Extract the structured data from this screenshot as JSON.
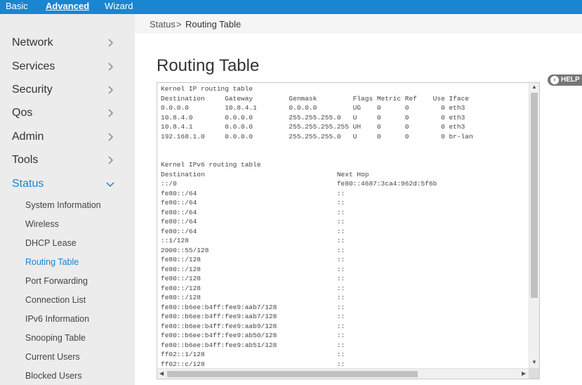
{
  "topbar": {
    "tabs": [
      {
        "label": "Basic"
      },
      {
        "label": "Advanced"
      },
      {
        "label": "Wizard"
      }
    ]
  },
  "sidebar": {
    "items": [
      {
        "label": "Network"
      },
      {
        "label": "Services"
      },
      {
        "label": "Security"
      },
      {
        "label": "Qos"
      },
      {
        "label": "Admin"
      },
      {
        "label": "Tools"
      },
      {
        "label": "Status"
      }
    ],
    "status_subitems": [
      {
        "label": "System Information"
      },
      {
        "label": "Wireless"
      },
      {
        "label": "DHCP Lease"
      },
      {
        "label": "Routing Table"
      },
      {
        "label": "Port Forwarding"
      },
      {
        "label": "Connection List"
      },
      {
        "label": "IPv6 Information"
      },
      {
        "label": "Snooping Table"
      },
      {
        "label": "Current Users"
      },
      {
        "label": "Blocked Users"
      }
    ]
  },
  "breadcrumb": {
    "parent": "Status",
    "separator": ">",
    "current": "Routing Table"
  },
  "main": {
    "title": "Routing Table",
    "help_label": "HELP",
    "routing_text": "Kernel IP routing table\nDestination     Gateway         Genmask         Flags Metric Ref    Use Iface\n0.0.0.0         10.8.4.1        0.0.0.0         UG    0      0        0 eth3\n10.8.4.0        0.0.0.0         255.255.255.0   U     0      0        0 eth3\n10.8.4.1        0.0.0.0         255.255.255.255 UH    0      0        0 eth3\n192.168.1.0     0.0.0.0         255.255.255.0   U     0      0        0 br-lan\n\n\nKernel IPv6 routing table\nDestination                                 Next Hop\n::/0                                        fe80::4687:3ca4:962d:5f6b\nfe80::/64                                   ::\nfe80::/64                                   ::\nfe80::/64                                   ::\nfe80::/64                                   ::\nfe80::/64                                   ::\n::1/128                                     ::\n2000::55/128                                ::\nfe80::/128                                  ::\nfe80::/128                                  ::\nfe80::/128                                  ::\nfe80::/128                                  ::\nfe80::/128                                  ::\nfe80::b6ee:b4ff:fee9:aab7/128               ::\nfe80::b6ee:b4ff:fee9:aab7/128               ::\nfe80::b6ee:b4ff:fee9:aab9/128               ::\nfe80::b6ee:b4ff:fee9:ab50/128               ::\nfe80::b6ee:b4ff:fee9:ab51/128               ::\nff02::1/128                                 ::\nff02::c/128                                 ::"
  },
  "colors": {
    "accent": "#1a85d0",
    "sidebar_bg": "#ececec"
  }
}
